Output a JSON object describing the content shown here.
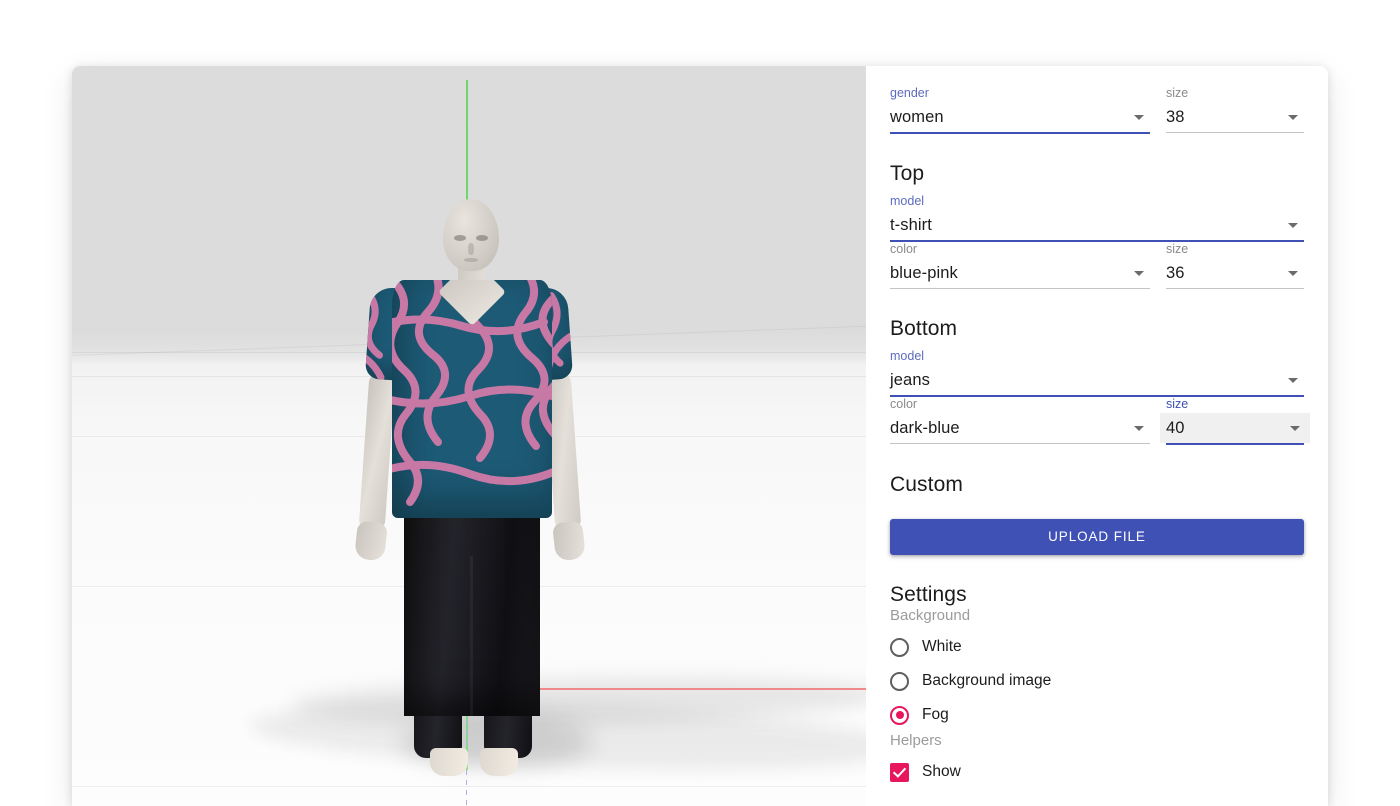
{
  "viewport": {
    "name": "3d-avatar-viewport",
    "axes": {
      "x_color": "#f08a8a",
      "y_color": "#62d662",
      "z_color": "#a9b6e0"
    },
    "garments": {
      "top_base_color": "#1d5a75",
      "top_pattern_color": "#d17ba8",
      "bottom_color": "#16161a",
      "skin_color": "#ddd8cf"
    }
  },
  "panel": {
    "person": {
      "gender": {
        "label": "gender",
        "value": "women"
      },
      "size": {
        "label": "size",
        "value": "38"
      }
    },
    "top": {
      "title": "Top",
      "model": {
        "label": "model",
        "value": "t-shirt"
      },
      "color": {
        "label": "color",
        "value": "blue-pink"
      },
      "size": {
        "label": "size",
        "value": "36"
      }
    },
    "bottom": {
      "title": "Bottom",
      "model": {
        "label": "model",
        "value": "jeans"
      },
      "color": {
        "label": "color",
        "value": "dark-blue"
      },
      "size": {
        "label": "size",
        "value": "40"
      }
    },
    "custom": {
      "title": "Custom",
      "upload_label": "UPLOAD FILE"
    },
    "settings": {
      "title": "Settings",
      "background_label": "Background",
      "background_options": [
        {
          "label": "White",
          "selected": false
        },
        {
          "label": "Background image",
          "selected": false
        },
        {
          "label": "Fog",
          "selected": true
        }
      ],
      "helpers_label": "Helpers",
      "helpers_options": [
        {
          "label": "Show",
          "checked": true
        }
      ]
    }
  },
  "colors": {
    "accent_primary": "#3f51b5",
    "accent_secondary": "#5c6bc0",
    "accent_selection": "#e8175d",
    "label_muted": "#9b9b9b"
  }
}
